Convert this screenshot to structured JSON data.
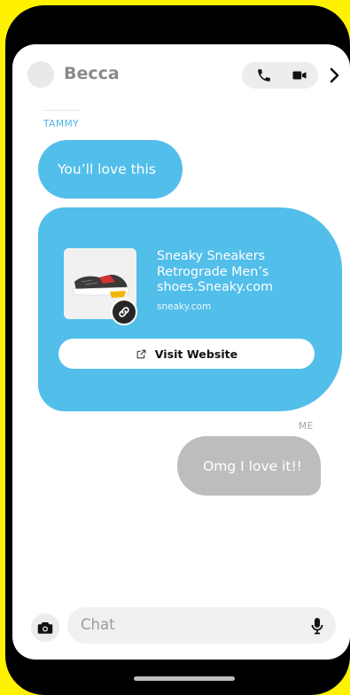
{
  "header": {
    "contact_name": "Becca",
    "call_icon": "phone-icon",
    "video_icon": "video-camera-icon",
    "more_icon": "chevron-right-icon"
  },
  "messages": {
    "incoming_sender": "TAMMY",
    "incoming_text": "You’ll love this",
    "link_preview": {
      "title": "Sneaky Sneakers Retrograde Men’s shoes.Sneaky.com",
      "domain": "sneaky.com",
      "button_label": "Visit Website"
    },
    "outgoing_sender": "ME",
    "outgoing_text": "Omg I love it!!"
  },
  "composer": {
    "placeholder": "Chat"
  },
  "colors": {
    "brand_yellow": "#FFF200",
    "incoming_bubble": "#52BEEA",
    "outgoing_bubble": "#BDBDBD"
  }
}
